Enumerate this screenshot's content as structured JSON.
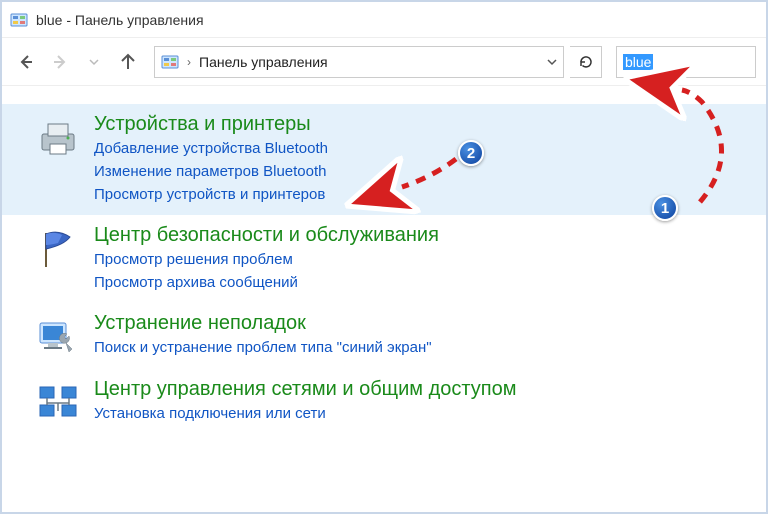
{
  "window": {
    "title": "blue - Панель управления"
  },
  "nav": {
    "breadcrumb": "Панель управления"
  },
  "search": {
    "value": "blue"
  },
  "results": [
    {
      "title": "Устройства и принтеры",
      "links": [
        "Добавление устройства Bluetooth",
        "Изменение параметров Bluetooth",
        "Просмотр устройств и принтеров"
      ],
      "highlighted": true
    },
    {
      "title": "Центр безопасности и обслуживания",
      "links": [
        "Просмотр решения проблем",
        "Просмотр архива сообщений"
      ],
      "highlighted": false
    },
    {
      "title": "Устранение неполадок",
      "links": [
        "Поиск и устранение проблем типа \"синий экран\""
      ],
      "highlighted": false
    },
    {
      "title": "Центр управления сетями и общим доступом",
      "links": [
        "Установка подключения или сети"
      ],
      "highlighted": false
    }
  ],
  "annotations": {
    "badge1": "1",
    "badge2": "2"
  }
}
